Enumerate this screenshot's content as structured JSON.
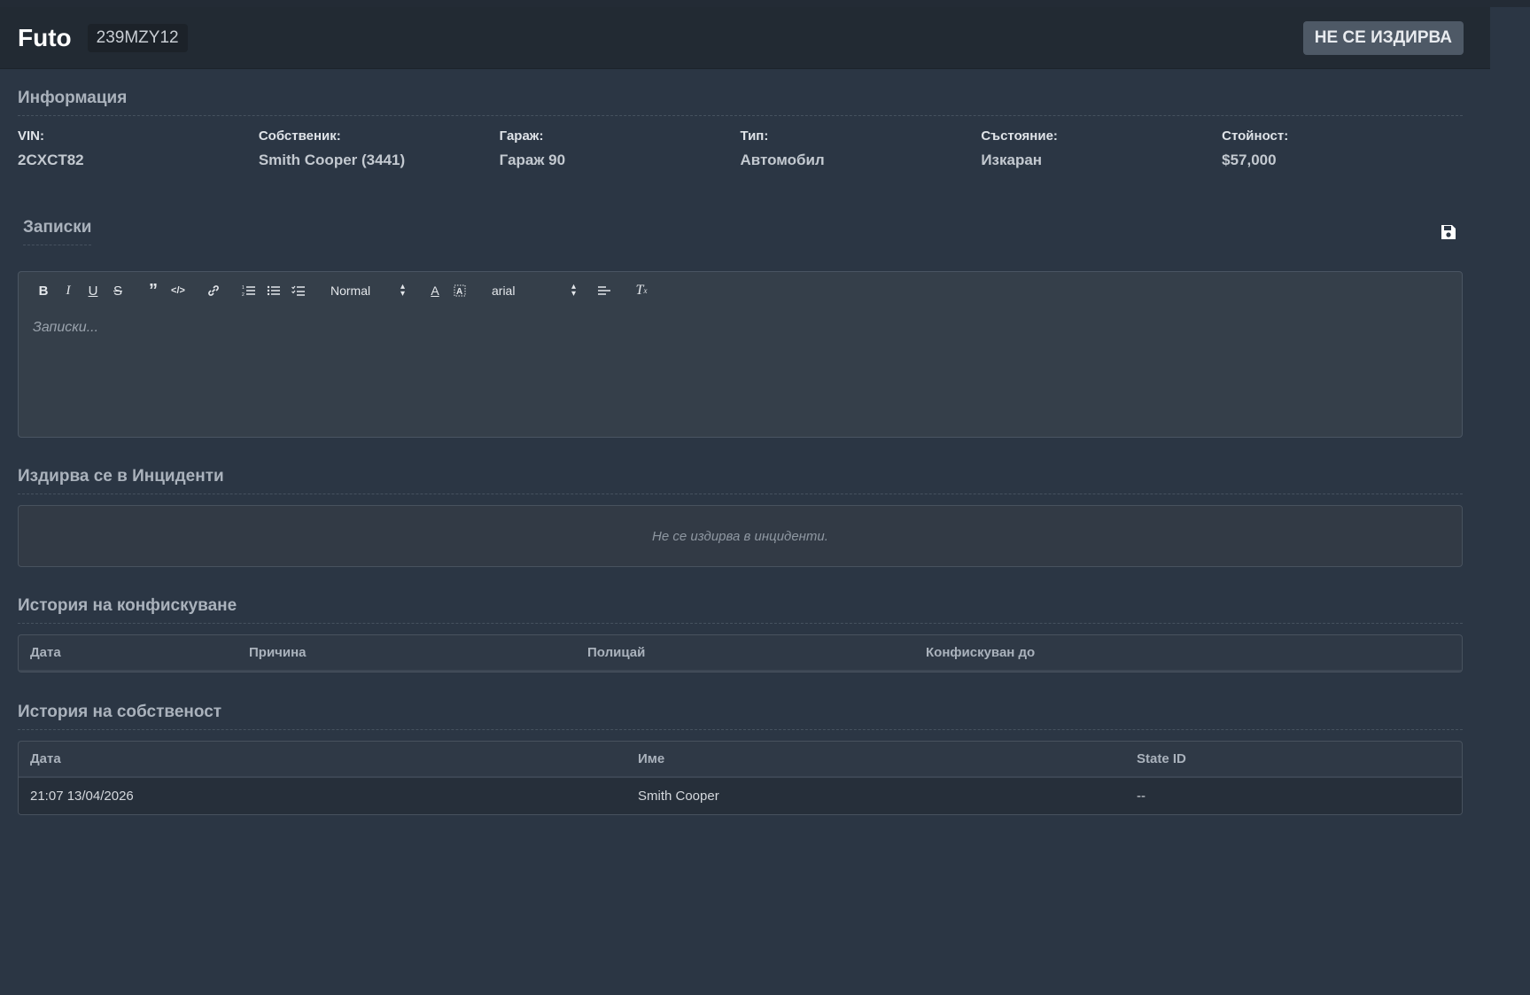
{
  "header": {
    "model": "Futo",
    "plate": "239MZY12",
    "status_button": "НЕ СЕ ИЗДИРВА"
  },
  "info": {
    "title": "Информация",
    "fields": [
      {
        "label": "VIN:",
        "value": "2CXCT82"
      },
      {
        "label": "Собственик:",
        "value": "Smith Cooper (3441)"
      },
      {
        "label": "Гараж:",
        "value": "Гараж 90"
      },
      {
        "label": "Тип:",
        "value": "Автомобил"
      },
      {
        "label": "Състояние:",
        "value": "Изкаран"
      },
      {
        "label": "Стойност:",
        "value": "$57,000"
      }
    ]
  },
  "notes": {
    "title": "Записки",
    "placeholder": "Записки...",
    "toolbar": {
      "header_select": "Normal",
      "font_select": "arial"
    }
  },
  "incidents": {
    "title": "Издирва се в Инциденти",
    "empty_text": "Не се издирва в инциденти."
  },
  "impound": {
    "title": "История на конфискуване",
    "columns": [
      "Дата",
      "Причина",
      "Полицай",
      "Конфискуван до"
    ]
  },
  "ownership": {
    "title": "История на собственост",
    "columns": [
      "Дата",
      "Име",
      "State ID"
    ],
    "rows": [
      [
        "21:07 13/04/2026",
        "Smith Cooper",
        "--"
      ]
    ]
  },
  "icons": {
    "save": "floppy-disk-icon"
  }
}
